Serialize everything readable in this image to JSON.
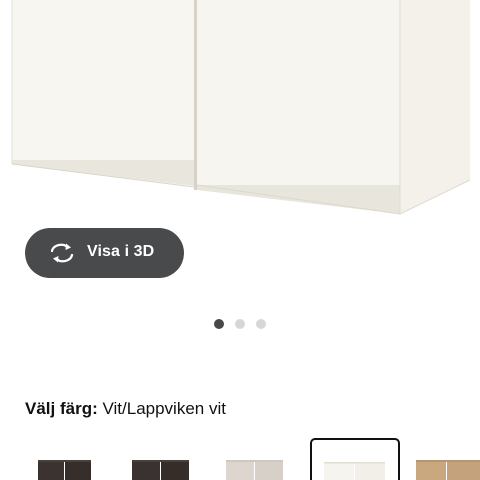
{
  "product_image": {
    "alt_icon": "wall-cabinet-white-image"
  },
  "view_3d": {
    "label": "Visa i 3D",
    "icon": "rotate-3d-icon"
  },
  "carousel": {
    "total": 3,
    "active": 1
  },
  "color": {
    "key_label": "Välj färg:",
    "value": "Vit/Lappviken vit"
  },
  "swatches": [
    {
      "name": "dark-brown",
      "color": "#3b3330",
      "selected": false
    },
    {
      "name": "dark-brown-2",
      "color": "#3a3230",
      "selected": false
    },
    {
      "name": "beige-grey",
      "color": "#dcd6cf",
      "selected": false
    },
    {
      "name": "white",
      "color": "#f6f4ee",
      "selected": true
    },
    {
      "name": "oak",
      "color": "#c9a880",
      "selected": false
    }
  ]
}
